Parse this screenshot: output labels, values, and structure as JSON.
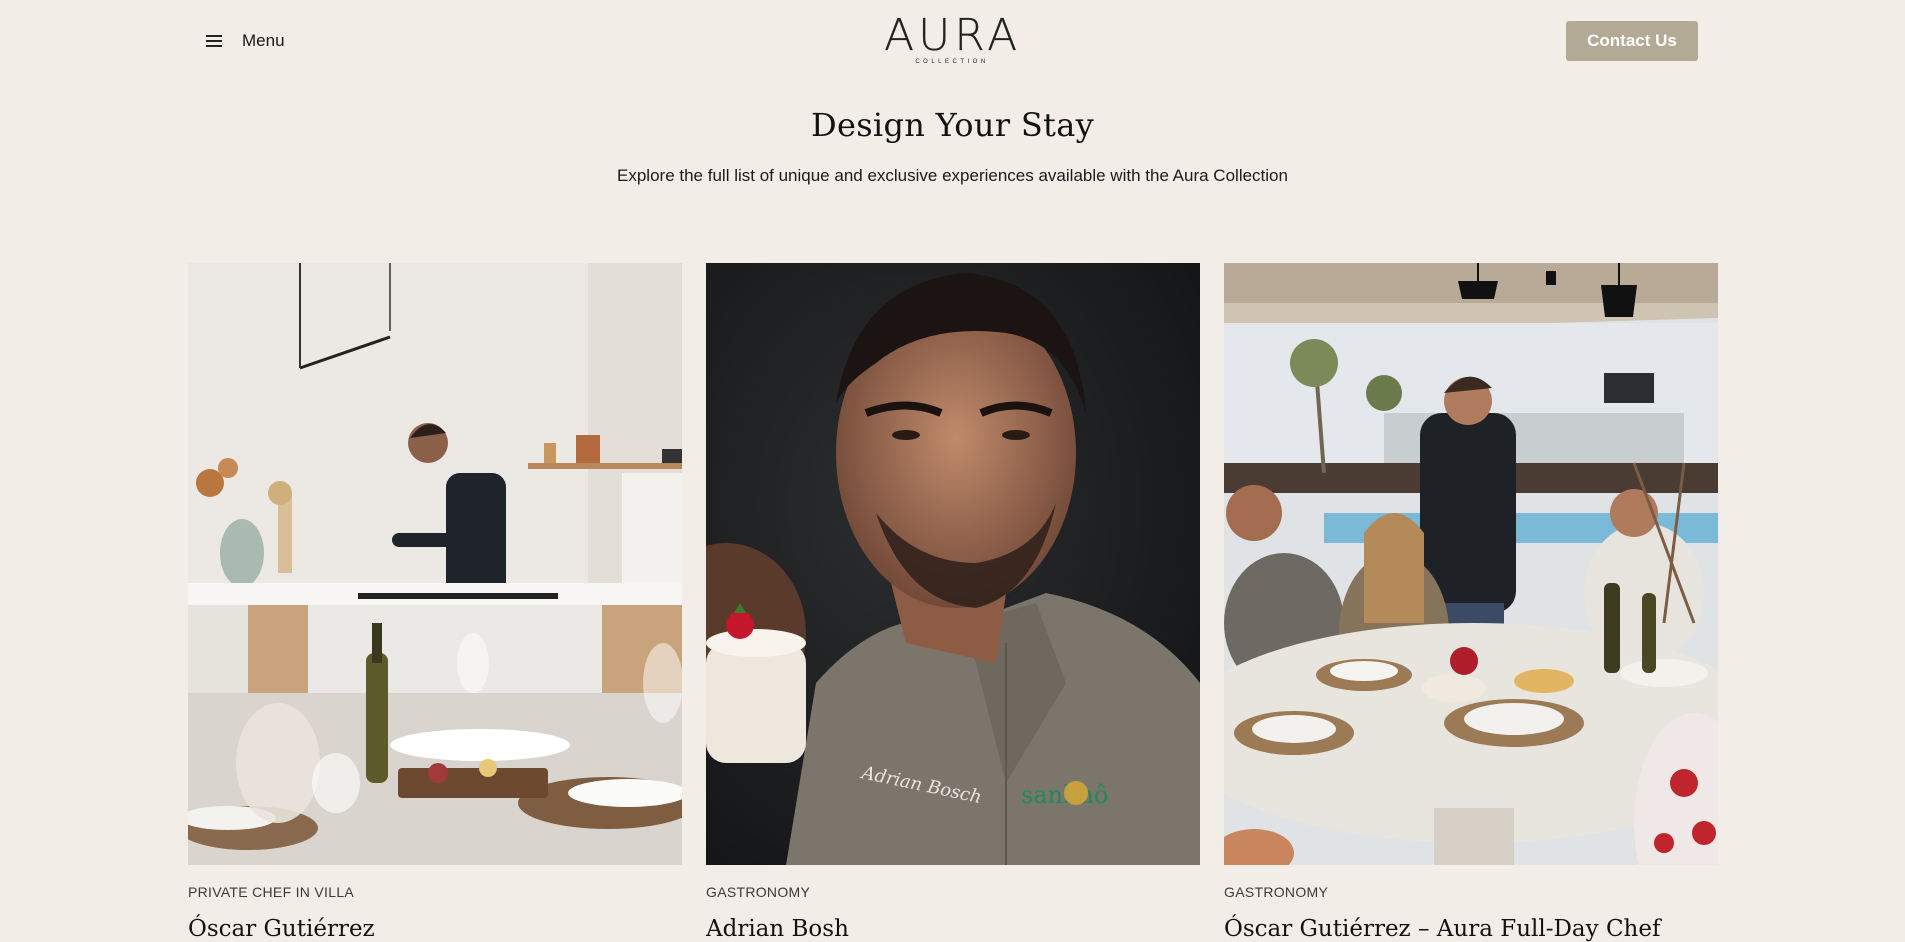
{
  "header": {
    "menu_label": "Menu",
    "logo_text": "AURA",
    "logo_subtext": "COLLECTION",
    "contact_label": "Contact Us"
  },
  "hero": {
    "title": "Design Your Stay",
    "subtitle": "Explore the full list of unique and exclusive experiences available with the Aura Collection"
  },
  "cards": [
    {
      "category": "PRIVATE CHEF IN VILLA",
      "title": "Óscar Gutiérrez"
    },
    {
      "category": "GASTRONOMY",
      "title": "Adrian Bosh"
    },
    {
      "category": "GASTRONOMY",
      "title": "Óscar Gutiérrez – Aura Full-Day Chef"
    }
  ],
  "card_2_embroidery": {
    "script_name": "Adrian Bosch",
    "brand": "sanbhô"
  },
  "colors": {
    "background": "#f2eee7",
    "contact_button": "#b3aa96",
    "text": "#1a1a1a"
  }
}
